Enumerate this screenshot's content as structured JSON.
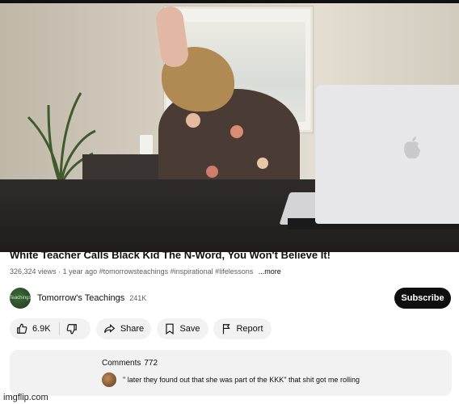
{
  "video": {
    "title": "White Teacher Calls Black Kid The N-Word, You Won't Believe It!",
    "views": "326,324 views",
    "age": "1 year ago",
    "hashtags": "#tomorrowsteachings #inspirational #lifelessons",
    "more_label": "...more"
  },
  "channel": {
    "name": "Tomorrow's Teachings",
    "subscribers": "241K",
    "avatar_text": "Teachings",
    "subscribe_label": "Subscribe"
  },
  "actions": {
    "likes": "6.9K",
    "share_label": "Share",
    "save_label": "Save",
    "report_label": "Report"
  },
  "comments": {
    "label": "Comments",
    "count": "772",
    "top_comment": "\" later they found out that she was part of the KKK\" that shit got me rolling"
  },
  "watermark": "imgflip.com",
  "icons": {
    "like": "thumbs-up-icon",
    "dislike": "thumbs-down-icon",
    "share": "share-arrow-icon",
    "save": "bookmark-icon",
    "report": "flag-icon"
  }
}
